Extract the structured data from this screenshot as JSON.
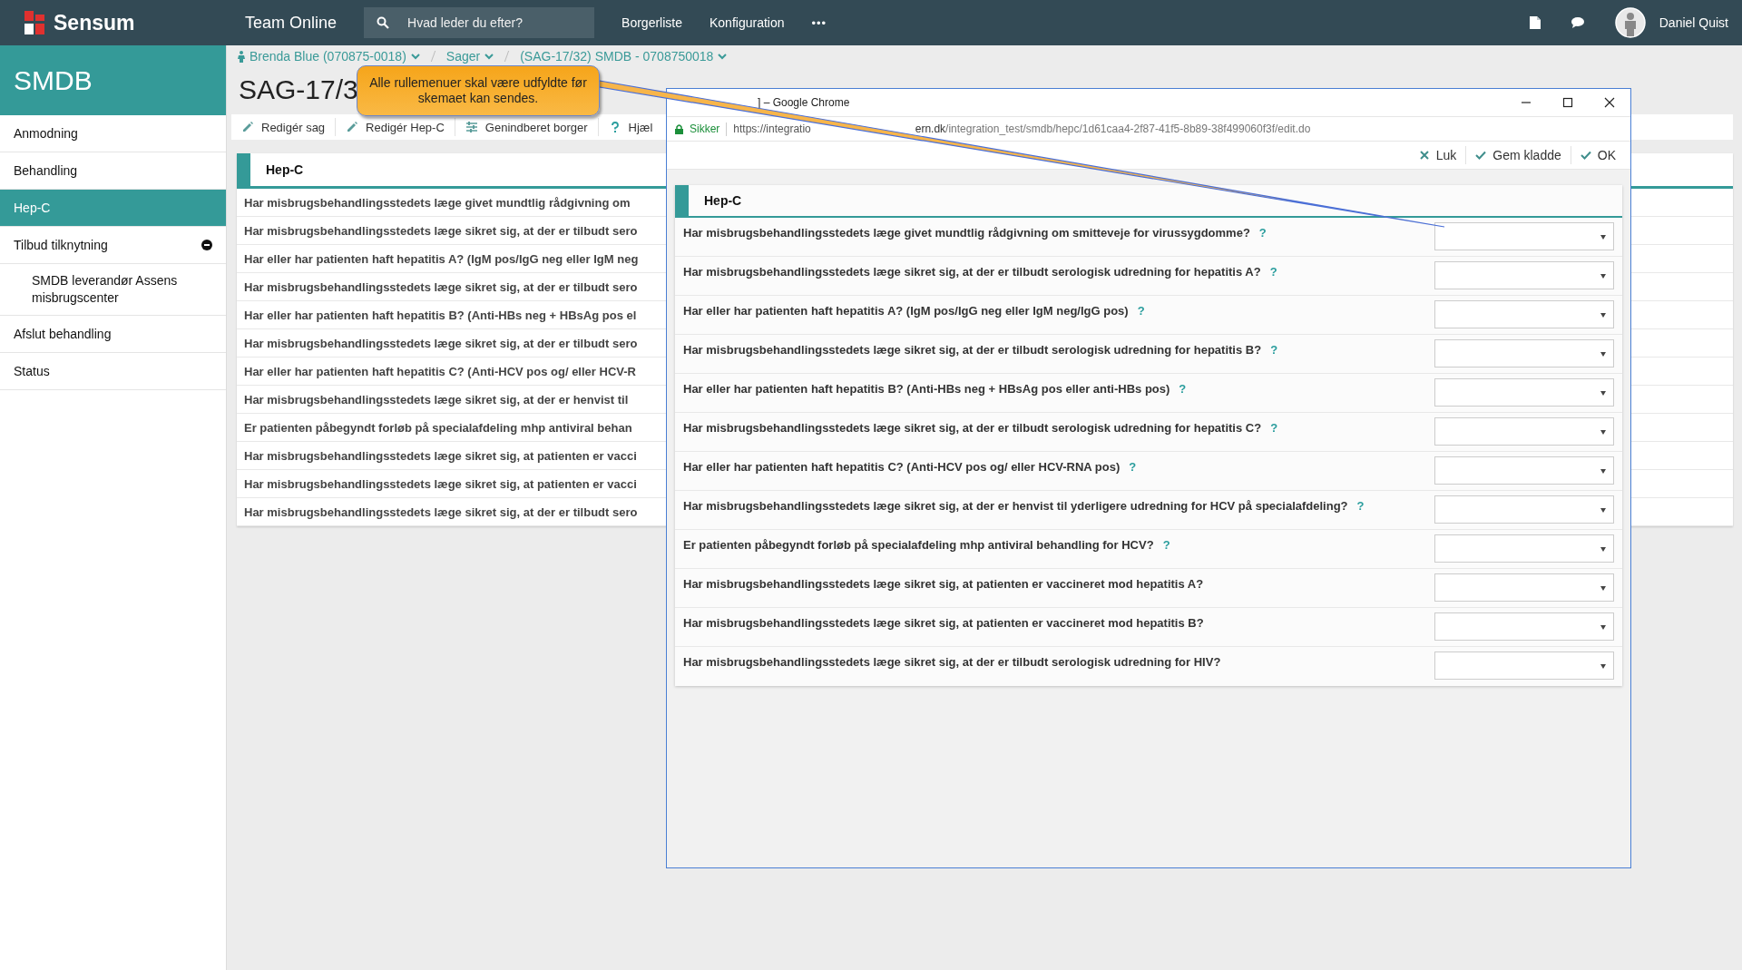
{
  "topbar": {
    "brand": "Sensum",
    "app": "Team Online",
    "search": {
      "placeholder": "Hvad leder du efter?"
    },
    "nav": [
      "Borgerliste",
      "Konfiguration"
    ],
    "more": "•••",
    "user": "Daniel Quist"
  },
  "sidebar": {
    "title": "SMDB",
    "items": [
      {
        "label": "Anmodning",
        "selected": false
      },
      {
        "label": "Behandling",
        "selected": false
      },
      {
        "label": "Hep-C",
        "selected": true
      },
      {
        "label": "Tilbud tilknytning",
        "selected": false,
        "expanded": true,
        "children": [
          {
            "label": "SMDB leverandør Assens misbrugscenter",
            "selected": false
          }
        ]
      },
      {
        "label": "Afslut behandling",
        "selected": false
      },
      {
        "label": "Status",
        "selected": false
      }
    ]
  },
  "breadcrumb": [
    {
      "label": "Brenda Blue (070875-0018)",
      "kind": "person"
    },
    {
      "label": "Sager",
      "kind": "plain"
    },
    {
      "label": "(SAG-17/32) SMDB - 0708750018",
      "kind": "plain"
    }
  ],
  "case_title": "SAG-17/3",
  "toolbar": [
    {
      "label": "Redigér sag",
      "kind": "edit"
    },
    {
      "label": "Redigér Hep-C",
      "kind": "edit"
    },
    {
      "label": "Genindberet borger",
      "kind": "citizen"
    },
    {
      "label": "Hjæl",
      "kind": "help"
    }
  ],
  "panel": {
    "title": "Hep-C",
    "rows": [
      "Har misbrugsbehandlingsstedets læge givet mundtlig rådgivning om",
      "Har misbrugsbehandlingsstedets læge sikret sig, at der er tilbudt sero",
      "Har eller har patienten haft hepatitis A? (IgM pos/IgG neg eller IgM neg",
      "Har misbrugsbehandlingsstedets læge sikret sig, at der er tilbudt sero",
      "Har eller har patienten haft hepatitis B? (Anti-HBs neg + HBsAg pos el",
      "Har misbrugsbehandlingsstedets læge sikret sig, at der er tilbudt sero",
      "Har eller har patienten haft hepatitis C? (Anti-HCV pos og/ eller HCV-R",
      "Har misbrugsbehandlingsstedets læge sikret sig, at der er henvist til",
      "Er patienten påbegyndt forløb på specialafdeling mhp antiviral behan",
      "Har misbrugsbehandlingsstedets læge sikret sig, at patienten er vacci",
      "Har misbrugsbehandlingsstedets læge sikret sig, at patienten er vacci",
      "Har misbrugsbehandlingsstedets læge sikret sig, at der er tilbudt sero"
    ]
  },
  "popup": {
    "title": "] – Google Chrome",
    "security": "Sikker",
    "url_start": "https://integratio",
    "url_domain": "ern.dk",
    "url_path": "/integration_test/smdb/hepc/1d61caa4-2f87-41f5-8b89-38f499060f3f/edit.do",
    "actions": [
      {
        "label": "Luk",
        "kind": "close"
      },
      {
        "label": "Gem kladde",
        "kind": "save"
      },
      {
        "label": "OK",
        "kind": "confirm"
      }
    ],
    "section": "Hep-C",
    "questions": [
      {
        "text": "Har misbrugsbehandlingsstedets læge givet mundtlig rådgivning om smitteveje for virussygdomme?",
        "help": "?"
      },
      {
        "text": "Har misbrugsbehandlingsstedets læge sikret sig, at der er tilbudt serologisk udredning for hepatitis A?",
        "help": "?"
      },
      {
        "text": "Har eller har patienten haft hepatitis A? (IgM pos/IgG neg eller IgM neg/IgG pos)",
        "help": "?"
      },
      {
        "text": "Har misbrugsbehandlingsstedets læge sikret sig, at der er tilbudt serologisk udredning for hepatitis B?",
        "help": "?"
      },
      {
        "text": "Har eller har patienten haft hepatitis B? (Anti-HBs neg + HBsAg pos eller anti-HBs pos)",
        "help": "?"
      },
      {
        "text": "Har misbrugsbehandlingsstedets læge sikret sig, at der er tilbudt serologisk udredning for hepatitis C?",
        "help": "?"
      },
      {
        "text": "Har eller har patienten haft hepatitis C? (Anti-HCV pos og/ eller HCV-RNA pos)",
        "help": "?"
      },
      {
        "text": "Har misbrugsbehandlingsstedets læge sikret sig, at der er henvist til yderligere udredning for HCV på specialafdeling?",
        "help": "?"
      },
      {
        "text": "Er patienten påbegyndt forløb på specialafdeling mhp antiviral behandling for HCV?",
        "help": "?"
      },
      {
        "text": "Har misbrugsbehandlingsstedets læge sikret sig, at patienten er vaccineret mod hepatitis A?"
      },
      {
        "text": "Har misbrugsbehandlingsstedets læge sikret sig, at patienten er vaccineret mod hepatitis B?"
      },
      {
        "text": "Har misbrugsbehandlingsstedets læge sikret sig, at der er tilbudt serologisk udredning for HIV?"
      }
    ]
  },
  "callout": {
    "text": "Alle rullemenuer skal være udfyldte før skemaet kan sendes."
  }
}
